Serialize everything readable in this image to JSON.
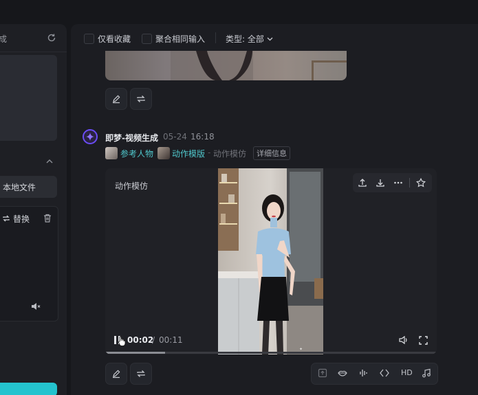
{
  "left_panel": {
    "title_fragment": "成",
    "local_file_button": "本地文件",
    "replace_button": "替换",
    "icons": [
      "refresh-icon",
      "chevron-up-icon",
      "replace-icon",
      "delete-icon",
      "volume-icon"
    ]
  },
  "filter_bar": {
    "collected_only": "仅看收藏",
    "merge_same_input": "聚合相同输入",
    "type_filter": "类型: 全部"
  },
  "message": {
    "app_name": "即梦-视频生成",
    "date": "05-24",
    "time": "16:18",
    "reference_tag": "参考人物",
    "template_tag": "动作模版",
    "separator": "-",
    "mode": "动作模仿",
    "details_button": "详细信息"
  },
  "player": {
    "caption": "动作模仿",
    "current_time": "00:02",
    "time_separator": "/",
    "total_time": "00:11",
    "progress_fraction": 0.18,
    "toolbar_icons": [
      "upload-icon",
      "download-icon",
      "more-icon",
      "star-icon"
    ]
  },
  "bottom_toolbar": {
    "hd_label": "HD",
    "icons": [
      "upscale-icon",
      "lip-sync-icon",
      "audio-wave-icon",
      "frame-interpolate-icon",
      "music-icon"
    ]
  },
  "colors": {
    "accent_teal": "#4fc6cb",
    "avatar_ring": "#6a4cf5",
    "background": "#16171b"
  }
}
